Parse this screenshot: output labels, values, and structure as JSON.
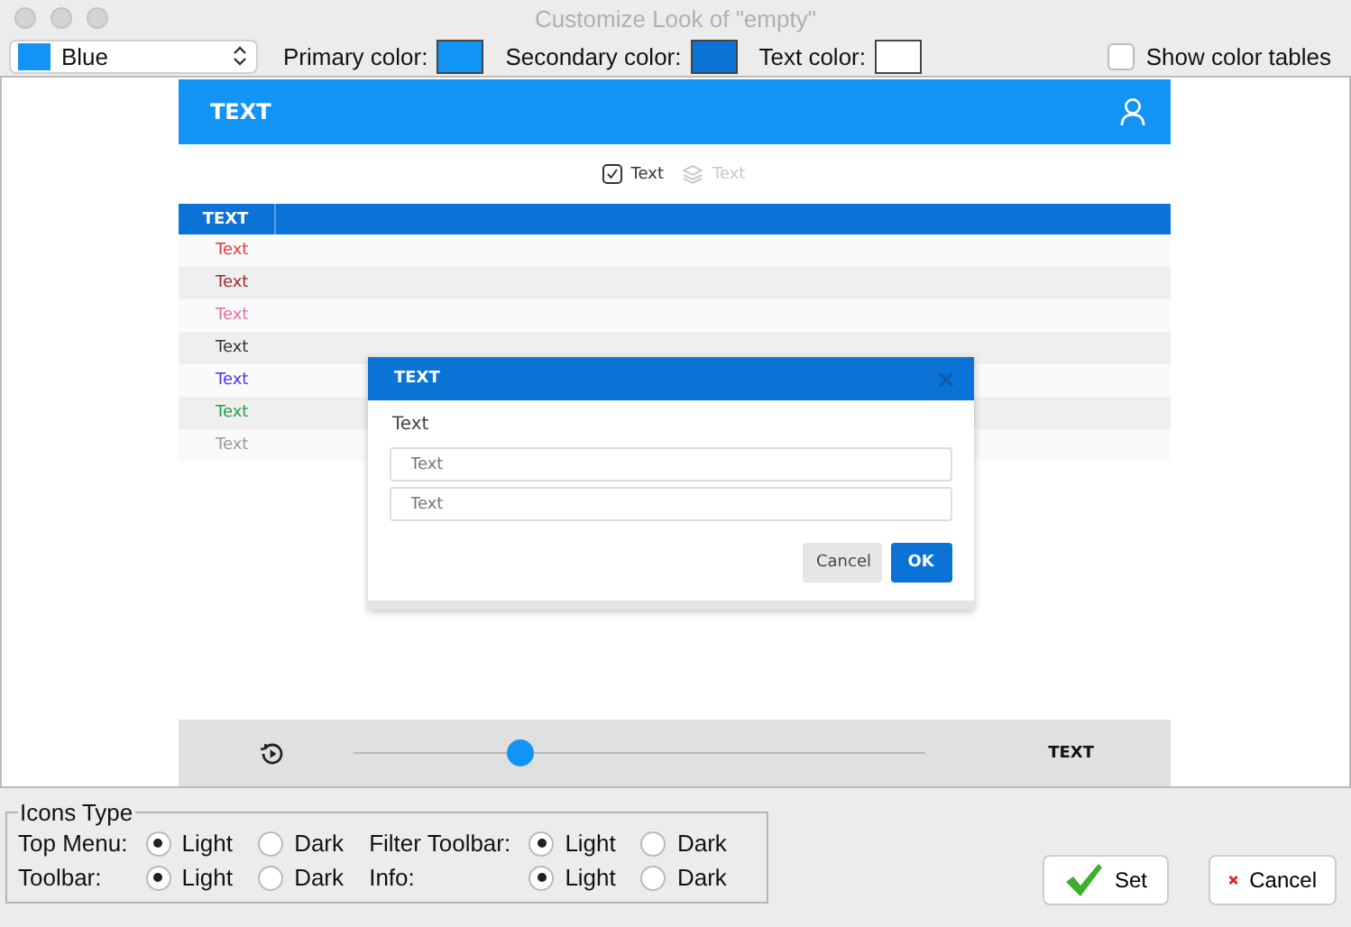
{
  "window": {
    "title": "Customize Look of \"empty\""
  },
  "toolbar": {
    "theme": {
      "label": "Blue",
      "color": "#1294f6"
    },
    "swatches": [
      {
        "label": "Primary color:",
        "color": "#1294f6"
      },
      {
        "label": "Secondary color:",
        "color": "#0b73d6"
      },
      {
        "label": "Text color:",
        "color": "#ffffff"
      }
    ],
    "show_color_tables": {
      "label": "Show color tables",
      "checked": false
    }
  },
  "preview": {
    "app_bar": {
      "title": "TEXT"
    },
    "actions": [
      {
        "kind": "checkbox",
        "label": "Text",
        "disabled": false
      },
      {
        "kind": "layers",
        "label": "Text",
        "disabled": true
      }
    ],
    "table": {
      "column": "TEXT",
      "rows": [
        {
          "text": "Text",
          "color": "#e53935"
        },
        {
          "text": "Text",
          "color": "#9b2d2d"
        },
        {
          "text": "Text",
          "color": "#e56fa5"
        },
        {
          "text": "Text",
          "color": "#333333"
        },
        {
          "text": "Text",
          "color": "#4a35e8"
        },
        {
          "text": "Text",
          "color": "#27a04a"
        },
        {
          "text": "Text",
          "color": "#9a9a9a"
        }
      ]
    },
    "dialog": {
      "title": "TEXT",
      "label": "Text",
      "fields": [
        {
          "placeholder": "Text"
        },
        {
          "placeholder": "Text"
        }
      ],
      "buttons": [
        {
          "kind": "secondary",
          "label": "Cancel"
        },
        {
          "kind": "primary",
          "label": "OK"
        }
      ]
    },
    "footer": {
      "level": 0.29,
      "label": "TEXT"
    }
  },
  "icons_type": {
    "title": "Icons Type",
    "groups": [
      {
        "label": "Top Menu:",
        "options": [
          {
            "label": "Light",
            "selected": true
          },
          {
            "label": "Dark",
            "selected": false
          }
        ]
      },
      {
        "label": "Filter Toolbar:",
        "options": [
          {
            "label": "Light",
            "selected": true
          },
          {
            "label": "Dark",
            "selected": false
          }
        ]
      },
      {
        "label": "Toolbar:",
        "options": [
          {
            "label": "Light",
            "selected": true
          },
          {
            "label": "Dark",
            "selected": false
          }
        ]
      },
      {
        "label": "Info:",
        "options": [
          {
            "label": "Light",
            "selected": true
          },
          {
            "label": "Dark",
            "selected": false
          }
        ]
      }
    ]
  },
  "buttons": [
    {
      "kind": "ok",
      "label": "Set"
    },
    {
      "kind": "cancel",
      "label": "Cancel"
    }
  ]
}
